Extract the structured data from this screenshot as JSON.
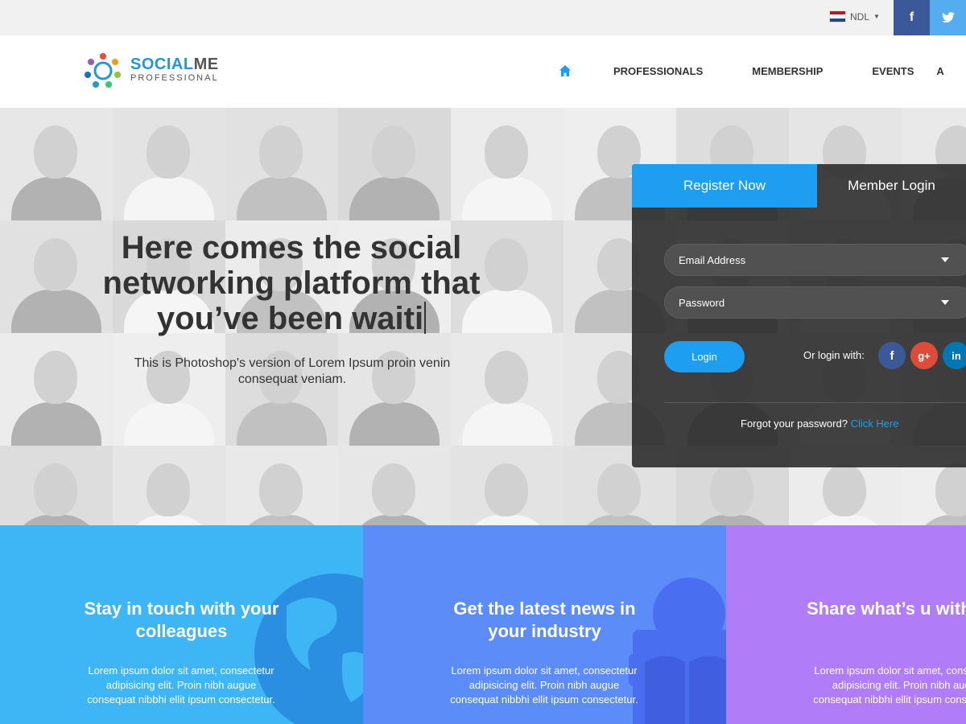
{
  "topbar": {
    "language": "NDL",
    "flag_colors": [
      "#ae1c28",
      "#ffffff",
      "#21468b"
    ],
    "social": [
      {
        "name": "facebook",
        "glyph": "f",
        "color": "#3b5998"
      },
      {
        "name": "twitter",
        "glyph": "🐦",
        "color": "#55acee"
      }
    ]
  },
  "logo": {
    "part1": "SOCIAL",
    "part2": "ME",
    "subtitle": "PROFESSIONAL"
  },
  "nav": {
    "home_icon": "home-icon",
    "items": [
      "PROFESSIONALS",
      "MEMBERSHIP",
      "EVENTS",
      "A"
    ]
  },
  "hero": {
    "title": "Here comes the social networking platform that you’ve been waiti",
    "subtitle": "This is Photoshop's version  of Lorem Ipsum proin venin consequat veniam."
  },
  "login_panel": {
    "tab_register": "Register Now",
    "tab_login": "Member Login",
    "email_placeholder": "Email Address",
    "password_placeholder": "Password",
    "login_button": "Login",
    "or_login_with": "Or login with:",
    "social": [
      {
        "name": "facebook",
        "glyph": "f",
        "color": "#3b5998"
      },
      {
        "name": "google-plus",
        "glyph": "g+",
        "color": "#dd4b39"
      },
      {
        "name": "linkedin",
        "glyph": "in",
        "color": "#0077b5"
      }
    ],
    "forgot_text": "Forgot your password?",
    "forgot_link": "Click Here"
  },
  "features": [
    {
      "title": "Stay in touch with your colleagues",
      "text": "Lorem ipsum dolor sit amet, consectetur adipisicing elit. Proin nibh augue consequat nibbhi ellit ipsum consectetur.",
      "color": "#3eb6f5",
      "icon": "globe-icon"
    },
    {
      "title": "Get the latest news in your industry",
      "text": "Lorem ipsum dolor sit amet, consectetur adipisicing elit. Proin nibh augue consequat nibbhi ellit ipsum consectetur.",
      "color": "#5b8cf7",
      "icon": "news-icon"
    },
    {
      "title": "Share what’s u with you",
      "text": "Lorem ipsum dolor sit amet, consectetur adipisicing elit. Proin nibh augue consequat nibbhi ellit ipsum consectetur.",
      "color": "#b07cf7",
      "icon": "share-icon"
    }
  ]
}
